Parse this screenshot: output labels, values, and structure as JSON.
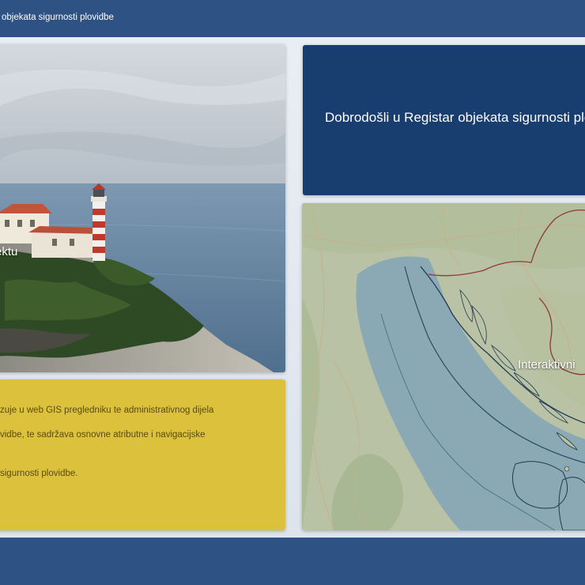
{
  "header": {
    "title": "objekata sigurnosti plovidbe"
  },
  "photo_card": {
    "label": "ektu"
  },
  "info_card": {
    "lines": [
      "zuje u web GIS pregledniku te administrativnog dijela",
      "vidbe, te sadržava osnovne atributne i navigacijske",
      "sigurnosti plovidbe."
    ]
  },
  "welcome_card": {
    "text": "Dobrodošli u Registar objekata sigurnosti plovidbe"
  },
  "map_card": {
    "label": "Interaktivni"
  },
  "colors": {
    "header_bg": "#2f5285",
    "welcome_bg": "#183d6f",
    "info_bg": "#dcc13d",
    "page_bg": "#dfe6ee"
  }
}
